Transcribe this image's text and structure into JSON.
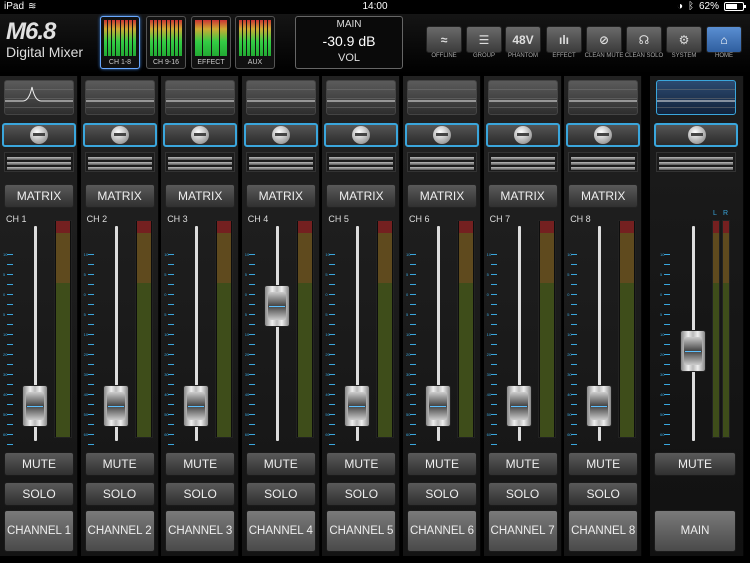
{
  "status_bar": {
    "device": "iPad",
    "time": "14:00",
    "battery": "62%"
  },
  "logo": {
    "model": "M6.8",
    "subtitle": "Digital Mixer"
  },
  "view_tabs": [
    {
      "label": "CH 1-8",
      "active": true
    },
    {
      "label": "CH 9-16",
      "active": false
    },
    {
      "label": "EFFECT",
      "active": false
    },
    {
      "label": "AUX",
      "active": false
    }
  ],
  "main_display": {
    "title": "MAIN",
    "value": "-30.9 dB",
    "param": "VOL"
  },
  "toolbar": [
    {
      "label": "OFFLINE",
      "icon": "wifi-icon",
      "glyph": "≈",
      "active": false
    },
    {
      "label": "GROUP",
      "icon": "group-icon",
      "glyph": "☰",
      "active": false
    },
    {
      "label": "PHANTOM",
      "icon": "phantom-48v-icon",
      "glyph": "48V",
      "active": false
    },
    {
      "label": "EFFECT",
      "icon": "effect-icon",
      "glyph": "ılı",
      "active": false
    },
    {
      "label": "CLEAN MUTE",
      "icon": "clean-mute-icon",
      "glyph": "⊘",
      "active": false
    },
    {
      "label": "CLEAN SOLO",
      "icon": "clean-solo-icon",
      "glyph": "☊",
      "active": false
    },
    {
      "label": "SYSTEM",
      "icon": "gear-icon",
      "glyph": "⚙",
      "active": false
    },
    {
      "label": "HOME",
      "icon": "home-icon",
      "glyph": "⌂",
      "active": true
    }
  ],
  "strip_labels": {
    "matrix": "MATRIX",
    "mute": "MUTE",
    "solo": "SOLO"
  },
  "scale_marks": [
    "10",
    "5",
    "0",
    "5",
    "10",
    "20",
    "30",
    "40",
    "50",
    "60"
  ],
  "channels": [
    {
      "id": "CH 1",
      "name": "CHANNEL 1",
      "fader": 0.08,
      "eq_peak": true
    },
    {
      "id": "CH 2",
      "name": "CHANNEL 2",
      "fader": 0.08,
      "eq_peak": false
    },
    {
      "id": "CH 3",
      "name": "CHANNEL 3",
      "fader": 0.08,
      "eq_peak": false
    },
    {
      "id": "CH 4",
      "name": "CHANNEL 4",
      "fader": 0.66,
      "eq_peak": false
    },
    {
      "id": "CH 5",
      "name": "CHANNEL 5",
      "fader": 0.08,
      "eq_peak": false
    },
    {
      "id": "CH 6",
      "name": "CHANNEL 6",
      "fader": 0.08,
      "eq_peak": false
    },
    {
      "id": "CH 7",
      "name": "CHANNEL 7",
      "fader": 0.08,
      "eq_peak": false
    },
    {
      "id": "CH 8",
      "name": "CHANNEL 8",
      "fader": 0.08,
      "eq_peak": false
    }
  ],
  "main_strip": {
    "name": "MAIN",
    "fader": 0.4,
    "meter_labels": [
      "L",
      "R"
    ]
  },
  "colors": {
    "accent": "#3aa6dc",
    "active_blue": "#3d7fd6"
  }
}
